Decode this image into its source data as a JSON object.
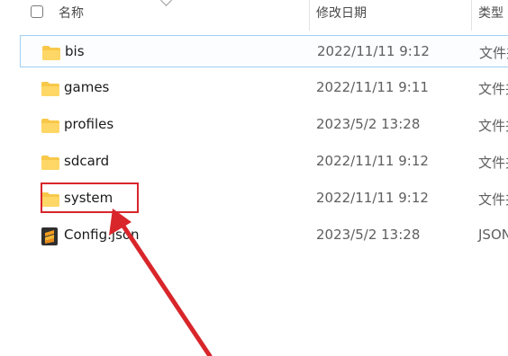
{
  "header": {
    "name_label": "名称",
    "date_label": "修改日期",
    "type_label": "类型"
  },
  "files": [
    {
      "name": "bis",
      "date": "2022/11/11 9:12",
      "type": "文件夹",
      "icon": "folder-icon"
    },
    {
      "name": "games",
      "date": "2022/11/11 9:11",
      "type": "文件夹",
      "icon": "folder-icon"
    },
    {
      "name": "profiles",
      "date": "2023/5/2 13:28",
      "type": "文件夹",
      "icon": "folder-icon"
    },
    {
      "name": "sdcard",
      "date": "2022/11/11 9:12",
      "type": "文件夹",
      "icon": "folder-icon"
    },
    {
      "name": "system",
      "date": "2022/11/11 9:12",
      "type": "文件夹",
      "icon": "folder-icon"
    },
    {
      "name": "Config.json",
      "date": "2023/5/2 13:28",
      "type": "JSON",
      "icon": "json-file-icon"
    }
  ],
  "colors": {
    "folder": "#f8c84a",
    "highlight": "#d8262b",
    "selection_border": "#9fd0f4"
  }
}
